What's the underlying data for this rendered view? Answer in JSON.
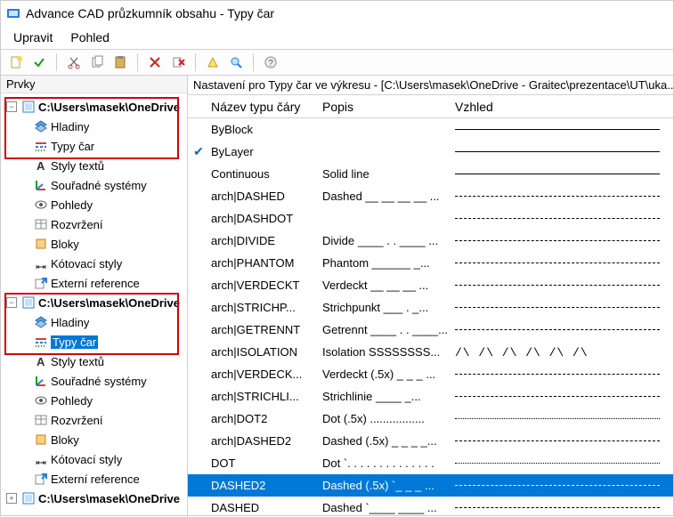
{
  "window": {
    "title": "Advance CAD průzkumník obsahu - Typy čar"
  },
  "menu": {
    "items": [
      "Upravit",
      "Pohled"
    ]
  },
  "toolbar": {
    "buttons": [
      {
        "name": "new-icon"
      },
      {
        "name": "check-icon"
      },
      {
        "sep": true
      },
      {
        "name": "cut-icon"
      },
      {
        "name": "copy-icon"
      },
      {
        "name": "paste-icon"
      },
      {
        "sep": true
      },
      {
        "name": "delete-icon"
      },
      {
        "name": "purge-icon"
      },
      {
        "sep": true
      },
      {
        "name": "highlight-icon"
      },
      {
        "name": "find-icon"
      },
      {
        "sep": true
      },
      {
        "name": "help-icon"
      }
    ]
  },
  "left_panel": {
    "title": "Prvky"
  },
  "tree": {
    "drawings": [
      {
        "label": "C:\\Users\\masek\\OneDrive",
        "children": [
          {
            "label": "Hladiny",
            "icon": "layers-icon"
          },
          {
            "label": "Typy čar",
            "icon": "linetypes-icon"
          },
          {
            "label": "Styly textů",
            "icon": "textstyle-icon"
          },
          {
            "label": "Souřadné systémy",
            "icon": "ucs-icon"
          },
          {
            "label": "Pohledy",
            "icon": "views-icon"
          },
          {
            "label": "Rozvržení",
            "icon": "layouts-icon"
          },
          {
            "label": "Bloky",
            "icon": "blocks-icon"
          },
          {
            "label": "Kótovací styly",
            "icon": "dimstyle-icon"
          },
          {
            "label": "Externí reference",
            "icon": "xref-icon"
          }
        ]
      },
      {
        "label": "C:\\Users\\masek\\OneDrive",
        "children": [
          {
            "label": "Hladiny",
            "icon": "layers-icon"
          },
          {
            "label": "Typy čar",
            "icon": "linetypes-icon",
            "selected": true
          },
          {
            "label": "Styly textů",
            "icon": "textstyle-icon"
          },
          {
            "label": "Souřadné systémy",
            "icon": "ucs-icon"
          },
          {
            "label": "Pohledy",
            "icon": "views-icon"
          },
          {
            "label": "Rozvržení",
            "icon": "layouts-icon"
          },
          {
            "label": "Bloky",
            "icon": "blocks-icon"
          },
          {
            "label": "Kótovací styly",
            "icon": "dimstyle-icon"
          },
          {
            "label": "Externí reference",
            "icon": "xref-icon"
          }
        ]
      },
      {
        "label": "C:\\Users\\masek\\OneDrive",
        "children": []
      }
    ]
  },
  "right_panel": {
    "settings_label": "Nastavení pro Typy čar ve výkresu - [C:\\Users\\masek\\OneDrive - Graitec\\prezentace\\UT\\uka...",
    "columns": {
      "name": "Název typu čáry",
      "desc": "Popis",
      "appearance": "Vzhled"
    },
    "rows": [
      {
        "name": "ByBlock",
        "desc": "",
        "pattern": "solid",
        "checked": false
      },
      {
        "name": "ByLayer",
        "desc": "",
        "pattern": "solid",
        "checked": true
      },
      {
        "name": "Continuous",
        "desc": "Solid line",
        "pattern": "solid"
      },
      {
        "name": "arch|DASHED",
        "desc": "Dashed __ __ __ __ ...",
        "pattern": "dashed"
      },
      {
        "name": "arch|DASHDOT",
        "desc": "",
        "pattern": "dashdot"
      },
      {
        "name": "arch|DIVIDE",
        "desc": "Divide ____ . . ____ ...",
        "pattern": "divide"
      },
      {
        "name": "arch|PHANTOM",
        "desc": "Phantom ______  _...",
        "pattern": "phantom"
      },
      {
        "name": "arch|VERDECKT",
        "desc": "Verdeckt __ __ __ ...",
        "pattern": "dashed"
      },
      {
        "name": "arch|STRICHP...",
        "desc": "Strichpunkt ___ . _...",
        "pattern": "dashdot"
      },
      {
        "name": "arch|GETRENNT",
        "desc": "Getrennt ____ . . ____...",
        "pattern": "divide"
      },
      {
        "name": "arch|ISOLATION",
        "desc": "Isolation SSSSSSSS...",
        "pattern": "zigzag"
      },
      {
        "name": "arch|VERDECK...",
        "desc": "Verdeckt (.5x) _ _ _ ...",
        "pattern": "dashed"
      },
      {
        "name": "arch|STRICHLI...",
        "desc": "Strichlinie ____  _...",
        "pattern": "dashed"
      },
      {
        "name": "arch|DOT2",
        "desc": "Dot (.5x) .................",
        "pattern": "dotted"
      },
      {
        "name": "arch|DASHED2",
        "desc": "Dashed (.5x) _ _ _ _...",
        "pattern": "dashed"
      },
      {
        "name": "DOT",
        "desc": "Dot `. . . . . . . . . . . . . .",
        "pattern": "dotted"
      },
      {
        "name": "DASHED2",
        "desc": "Dashed (.5x) `_ _ _ ...",
        "pattern": "dashed",
        "selected": true
      },
      {
        "name": "DASHED",
        "desc": "Dashed `____ ____ ...",
        "pattern": "dashed"
      }
    ]
  }
}
